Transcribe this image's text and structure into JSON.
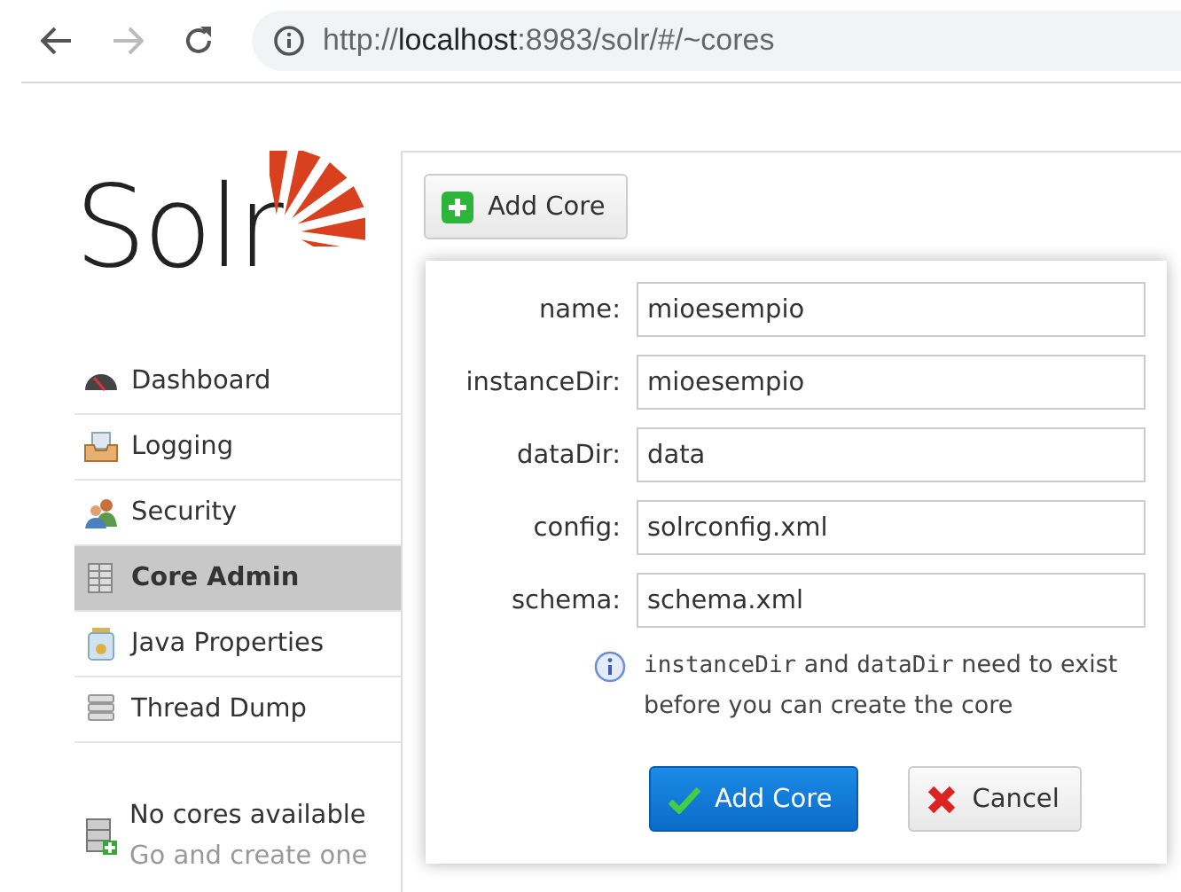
{
  "browser": {
    "back": {
      "disabled": false
    },
    "forward": {
      "disabled": true
    },
    "url": {
      "scheme": "http://",
      "host": "localhost",
      "path": ":8983/solr/#/~cores"
    }
  },
  "logo": "Solr",
  "nav": [
    {
      "label": "Dashboard",
      "selected": false
    },
    {
      "label": "Logging",
      "selected": false
    },
    {
      "label": "Security",
      "selected": false
    },
    {
      "label": "Core Admin",
      "selected": true
    },
    {
      "label": "Java Properties",
      "selected": false
    },
    {
      "label": "Thread Dump",
      "selected": false
    }
  ],
  "no_cores": {
    "title": "No cores available",
    "link": "Go and create one"
  },
  "add_core_button": "Add Core",
  "form": {
    "fields": [
      {
        "label": "name:",
        "value": "mioesempio"
      },
      {
        "label": "instanceDir:",
        "value": "mioesempio"
      },
      {
        "label": "dataDir:",
        "value": "data"
      },
      {
        "label": "config:",
        "value": "solrconfig.xml"
      },
      {
        "label": "schema:",
        "value": "schema.xml"
      }
    ],
    "hint": [
      {
        "kind": "code",
        "text": "instanceDir"
      },
      {
        "kind": "text",
        "text": " and "
      },
      {
        "kind": "code",
        "text": "dataDir"
      },
      {
        "kind": "text",
        "text": " need to exist before you can create the core"
      }
    ],
    "submit": "Add Core",
    "cancel": "Cancel"
  }
}
